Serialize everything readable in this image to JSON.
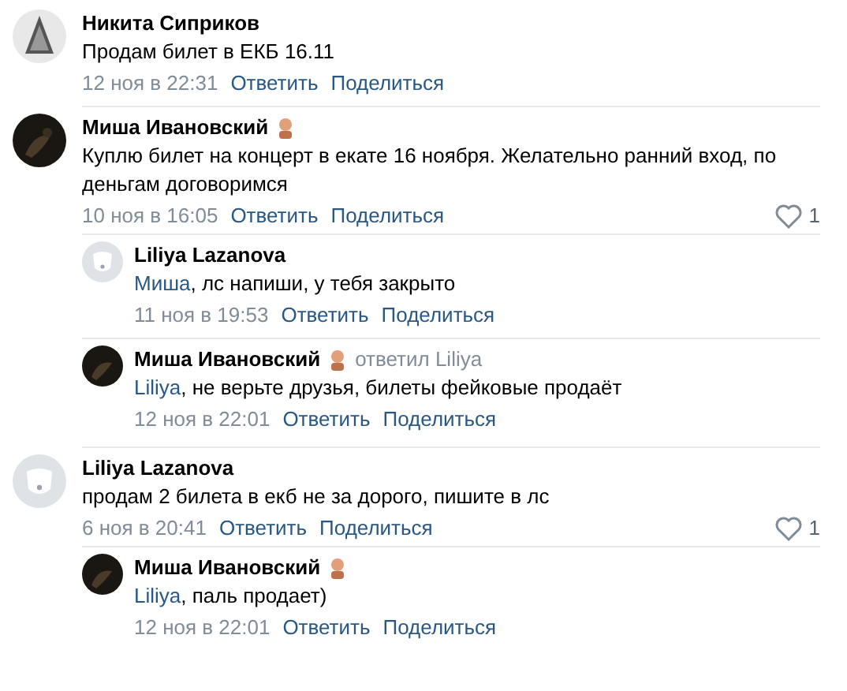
{
  "comments": [
    {
      "author": "Никита Сиприков",
      "badge": false,
      "text": "Продам билет в ЕКБ 16.11",
      "date": "12 ноя в 22:31",
      "reply": "Ответить",
      "share": "Поделиться"
    },
    {
      "author": "Миша Ивановский",
      "badge": true,
      "text": "Куплю билет на концерт в екате 16 ноября. Желательно ранний вход, по деньгам договоримся",
      "date": "10 ноя в 16:05",
      "reply": "Ответить",
      "share": "Поделиться",
      "likes": "1",
      "children": [
        {
          "author": "Liliya Lazanova",
          "badge": false,
          "mention": "Миша",
          "text": ", лс напиши, у тебя закрыто",
          "date": "11 ноя в 19:53",
          "reply": "Ответить",
          "share": "Поделиться"
        },
        {
          "author": "Миша Ивановский",
          "badge": true,
          "replied_to": "ответил Liliya",
          "mention": "Liliya",
          "text": ", не верьте друзья, билеты фейковые продаёт",
          "date": "12 ноя в 22:01",
          "reply": "Ответить",
          "share": "Поделиться"
        }
      ]
    },
    {
      "author": "Liliya Lazanova",
      "badge": false,
      "text": "продам 2 билета в екб не за дорого, пишите в лс",
      "date": "6 ноя в 20:41",
      "reply": "Ответить",
      "share": "Поделиться",
      "likes": "1",
      "children": [
        {
          "author": "Миша Ивановский",
          "badge": true,
          "mention": "Liliya",
          "text": ", паль продает)",
          "date": "12 ноя в 22:01",
          "reply": "Ответить",
          "share": "Поделиться"
        }
      ]
    }
  ]
}
